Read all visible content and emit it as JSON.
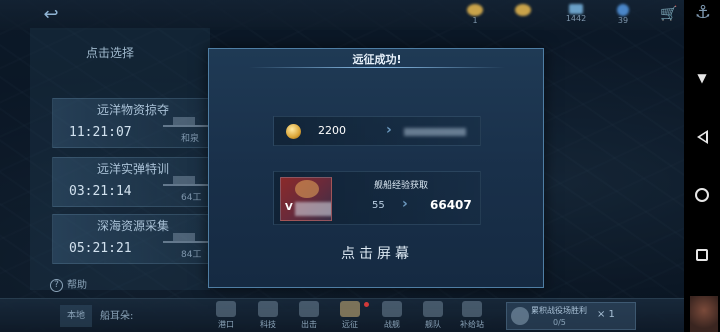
{
  "top_bar": {
    "back_icon": "back-arrow-icon",
    "resources": [
      {
        "icon": "gold-coin-icon",
        "value": "1"
      },
      {
        "icon": "gold-coin-icon",
        "value": ""
      },
      {
        "icon": "supply-icon",
        "value": "1442"
      },
      {
        "icon": "gem-icon",
        "value": "39"
      }
    ],
    "cart_icon": "shopping-cart-icon"
  },
  "left_panel": {
    "title": "点击选择",
    "missions": [
      {
        "title": "远洋物资掠夺",
        "time": "11:21:07",
        "tag": "和泉"
      },
      {
        "title": "远洋实弹特训",
        "time": "03:21:14",
        "tag": "64工"
      },
      {
        "title": "深海资源采集",
        "time": "05:21:21",
        "tag": "84工"
      }
    ],
    "help": "帮助"
  },
  "bottom_bar": {
    "left_label": "本地",
    "subtitle": "船耳朵:",
    "nav": [
      {
        "label": "港口",
        "icon": "port-icon"
      },
      {
        "label": "科技",
        "icon": "tech-icon"
      },
      {
        "label": "出击",
        "icon": "sortie-icon"
      },
      {
        "label": "远征",
        "icon": "expedition-icon"
      },
      {
        "label": "战舰",
        "icon": "warship-icon"
      },
      {
        "label": "舰队",
        "icon": "fleet-icon"
      },
      {
        "label": "补给站",
        "icon": "supply-station-icon"
      }
    ],
    "award": {
      "label": "累积战役场胜利",
      "value": "0/5",
      "multiplier": "× 1"
    }
  },
  "modal": {
    "title": "远征成功!",
    "reward": {
      "icon": "gold-coin-icon",
      "amount": "2200"
    },
    "exp": {
      "label": "舰船经验获取",
      "rank": "V",
      "from": "55",
      "to": "66407"
    },
    "hint": "点击屏幕"
  },
  "system_nav": [
    "menu-icon",
    "back-icon",
    "home-icon",
    "recent-apps-icon"
  ]
}
